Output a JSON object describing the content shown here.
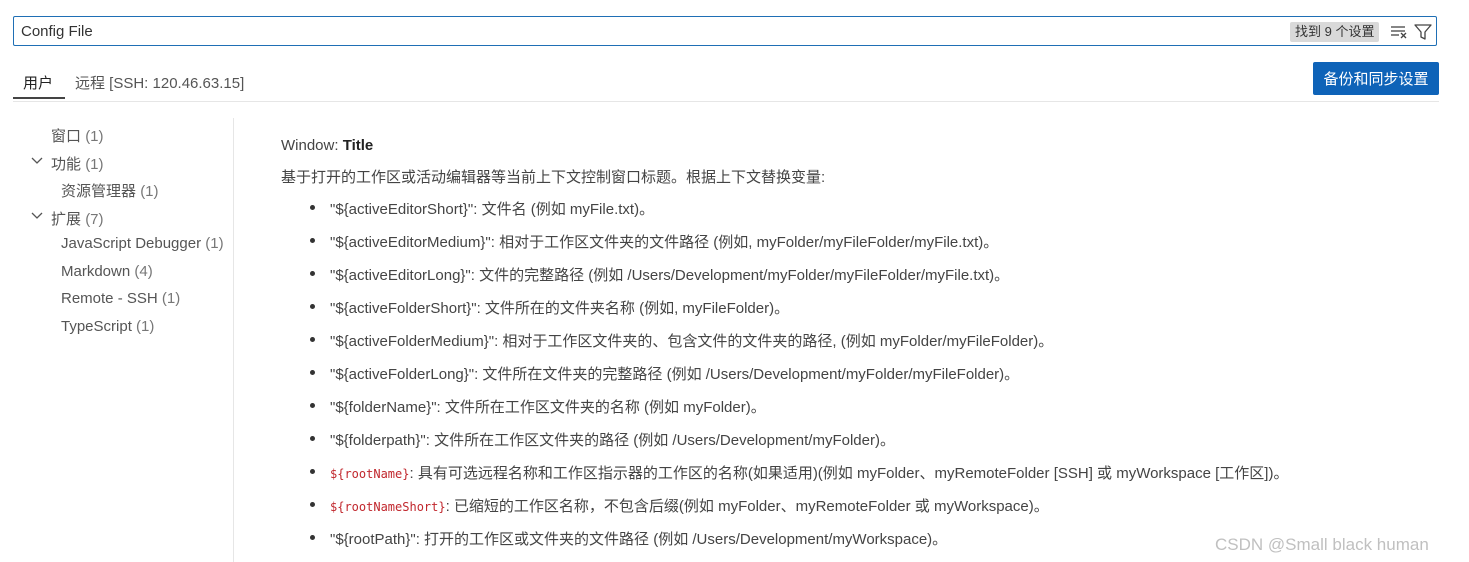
{
  "search": {
    "value": "Config File",
    "result_count": "找到 9 个设置",
    "clear_filter_icon": "clear-filter-icon",
    "filter_icon": "filter-icon"
  },
  "tabs": [
    {
      "label": "用户",
      "active": true
    },
    {
      "label": "远程 [SSH: 120.46.63.15]",
      "active": false
    }
  ],
  "sync_button": "备份和同步设置",
  "toc": [
    {
      "label": "窗口",
      "count": "(1)",
      "level": 1,
      "expandable": false
    },
    {
      "label": "功能",
      "count": "(1)",
      "level": 1,
      "expandable": true
    },
    {
      "label": "资源管理器",
      "count": "(1)",
      "level": 2,
      "expandable": false
    },
    {
      "label": "扩展",
      "count": "(7)",
      "level": 1,
      "expandable": true
    },
    {
      "label": "JavaScript Debugger",
      "count": "(1)",
      "level": 2,
      "expandable": false
    },
    {
      "label": "Markdown",
      "count": "(4)",
      "level": 2,
      "expandable": false
    },
    {
      "label": "Remote - SSH",
      "count": "(1)",
      "level": 2,
      "expandable": false
    },
    {
      "label": "TypeScript",
      "count": "(1)",
      "level": 2,
      "expandable": false
    }
  ],
  "setting": {
    "category": "Window: ",
    "name": "Title",
    "description": "基于打开的工作区或活动编辑器等当前上下文控制窗口标题。根据上下文替换变量:",
    "variables": [
      {
        "code": false,
        "var": "\"${activeEditorShort}\"",
        "desc": ": 文件名 (例如 myFile.txt)。"
      },
      {
        "code": false,
        "var": "\"${activeEditorMedium}\"",
        "desc": ": 相对于工作区文件夹的文件路径 (例如, myFolder/myFileFolder/myFile.txt)。"
      },
      {
        "code": false,
        "var": "\"${activeEditorLong}\"",
        "desc": ": 文件的完整路径 (例如 /Users/Development/myFolder/myFileFolder/myFile.txt)。"
      },
      {
        "code": false,
        "var": "\"${activeFolderShort}\"",
        "desc": ": 文件所在的文件夹名称 (例如, myFileFolder)。"
      },
      {
        "code": false,
        "var": "\"${activeFolderMedium}\"",
        "desc": ": 相对于工作区文件夹的、包含文件的文件夹的路径, (例如 myFolder/myFileFolder)。"
      },
      {
        "code": false,
        "var": "\"${activeFolderLong}\"",
        "desc": ": 文件所在文件夹的完整路径 (例如 /Users/Development/myFolder/myFileFolder)。"
      },
      {
        "code": false,
        "var": "\"${folderName}\"",
        "desc": ": 文件所在工作区文件夹的名称 (例如 myFolder)。"
      },
      {
        "code": false,
        "var": "\"${folderpath}\"",
        "desc": ": 文件所在工作区文件夹的路径 (例如 /Users/Development/myFolder)。"
      },
      {
        "code": true,
        "var": "${rootName}",
        "desc": ": 具有可选远程名称和工作区指示器的工作区的名称(如果适用)(例如 myFolder、myRemoteFolder [SSH] 或 myWorkspace [工作区])。"
      },
      {
        "code": true,
        "var": "${rootNameShort}",
        "desc": ": 已缩短的工作区名称，不包含后缀(例如 myFolder、myRemoteFolder 或 myWorkspace)。"
      },
      {
        "code": false,
        "var": "\"${rootPath}\"",
        "desc": ": 打开的工作区或文件夹的文件路径 (例如 /Users/Development/myWorkspace)。"
      }
    ]
  },
  "watermark": "CSDN @Small black human"
}
